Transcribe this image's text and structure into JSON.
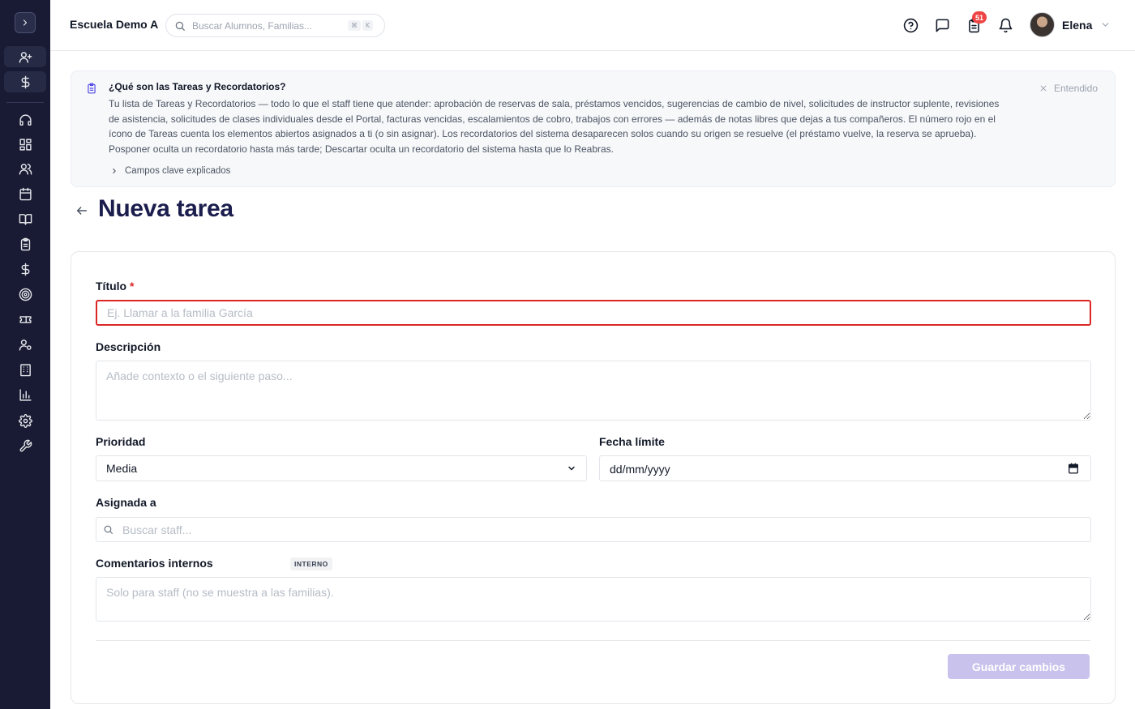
{
  "header": {
    "school_name": "Escuela Demo A",
    "search_placeholder": "Buscar Alumnos, Familias...",
    "kbd_cmd": "⌘",
    "kbd_key": "K",
    "tasks_badge": "51",
    "user_name": "Elena"
  },
  "info": {
    "title": "¿Qué son las Tareas y Recordatorios?",
    "body": "Tu lista de Tareas y Recordatorios — todo lo que el staff tiene que atender: aprobación de reservas de sala, préstamos vencidos, sugerencias de cambio de nivel, solicitudes de instructor suplente, revisiones de asistencia, solicitudes de clases individuales desde el Portal, facturas vencidas, escalamientos de cobro, trabajos con errores — además de notas libres que dejas a tus compañeros. El número rojo en el ícono de Tareas cuenta los elementos abiertos asignados a ti (o sin asignar). Los recordatorios del sistema desaparecen solos cuando su origen se resuelve (el préstamo vuelve, la reserva se aprueba). Posponer oculta un recordatorio hasta más tarde; Descartar oculta un recordatorio del sistema hasta que lo Reabras.",
    "dismiss_label": "Entendido",
    "expander_label": "Campos clave explicados"
  },
  "page": {
    "title": "Nueva tarea"
  },
  "form": {
    "title_label": "Título",
    "title_required": "*",
    "title_placeholder": "Ej. Llamar a la familia García",
    "description_label": "Descripción",
    "description_placeholder": "Añade contexto o el siguiente paso...",
    "priority_label": "Prioridad",
    "priority_value": "Media",
    "due_label": "Fecha límite",
    "due_value": "dd/mm/yyyy",
    "assigned_label": "Asignada a",
    "assigned_placeholder": "Buscar staff...",
    "comments_label": "Comentarios internos",
    "comments_tag": "INTERNO",
    "comments_placeholder": "Solo para staff (no se muestra a las familias).",
    "save_label": "Guardar cambios"
  },
  "colors": {
    "sidebar_bg": "#181b33",
    "accent": "#1b1d4d",
    "error": "#dc2626",
    "save_disabled": "#c8c2ec",
    "badge": "#ef4444"
  },
  "sidebar_icons": [
    "expand-icon",
    "user-plus-icon",
    "dollar-icon",
    "headset-icon",
    "dashboard-icon",
    "users-icon",
    "calendar-icon",
    "book-icon",
    "clipboard-icon",
    "dollar-icon",
    "target-icon",
    "ticket-icon",
    "user-settings-icon",
    "building-icon",
    "chart-icon",
    "settings-icon",
    "wrench-icon"
  ]
}
